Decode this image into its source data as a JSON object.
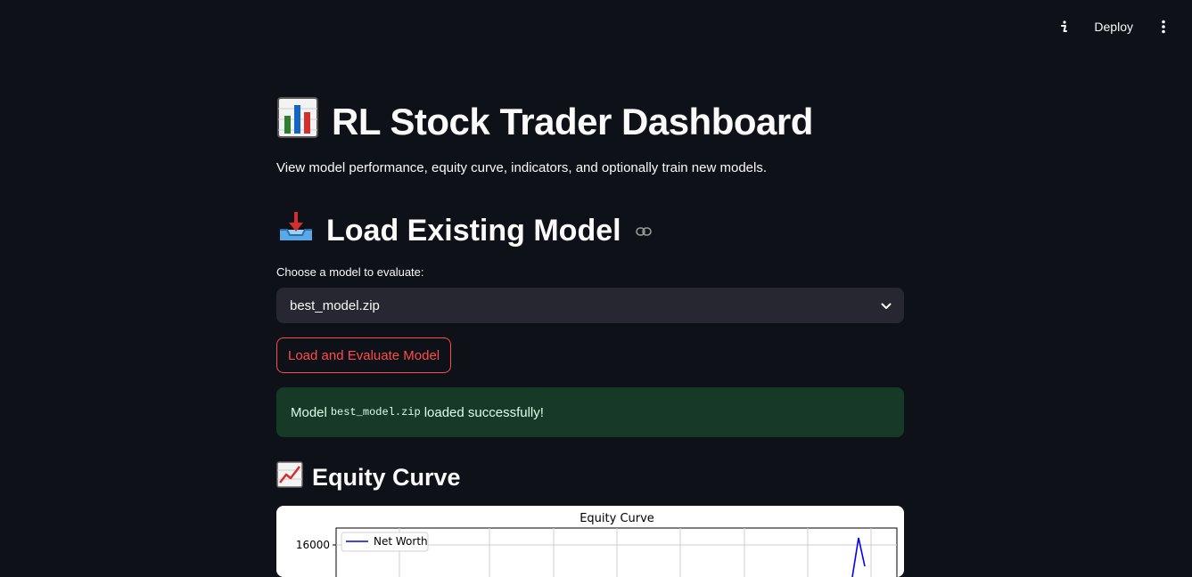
{
  "topbar": {
    "deploy_label": "Deploy"
  },
  "page": {
    "title": "RL Stock Trader Dashboard",
    "subtitle": "View model performance, equity curve, indicators, and optionally train new models."
  },
  "load_section": {
    "heading": "Load Existing Model",
    "select_label": "Choose a model to evaluate:",
    "selected_model": "best_model.zip",
    "button_label": "Load and Evaluate Model",
    "alert": {
      "prefix": "Model",
      "code": "best_model.zip",
      "suffix": "loaded successfully!"
    }
  },
  "equity_section": {
    "heading": "Equity Curve"
  },
  "colors": {
    "background": "#0e1117",
    "accent": "#ff4b4b",
    "success_bg": "#173928",
    "select_bg": "#262730",
    "series_line": "#0000ff"
  },
  "chart_data": {
    "type": "line",
    "title": "Equity Curve",
    "y_ticks": [
      16000
    ],
    "series": [
      {
        "name": "Net Worth",
        "values": []
      }
    ],
    "legend_position": "top-left",
    "grid": true
  }
}
